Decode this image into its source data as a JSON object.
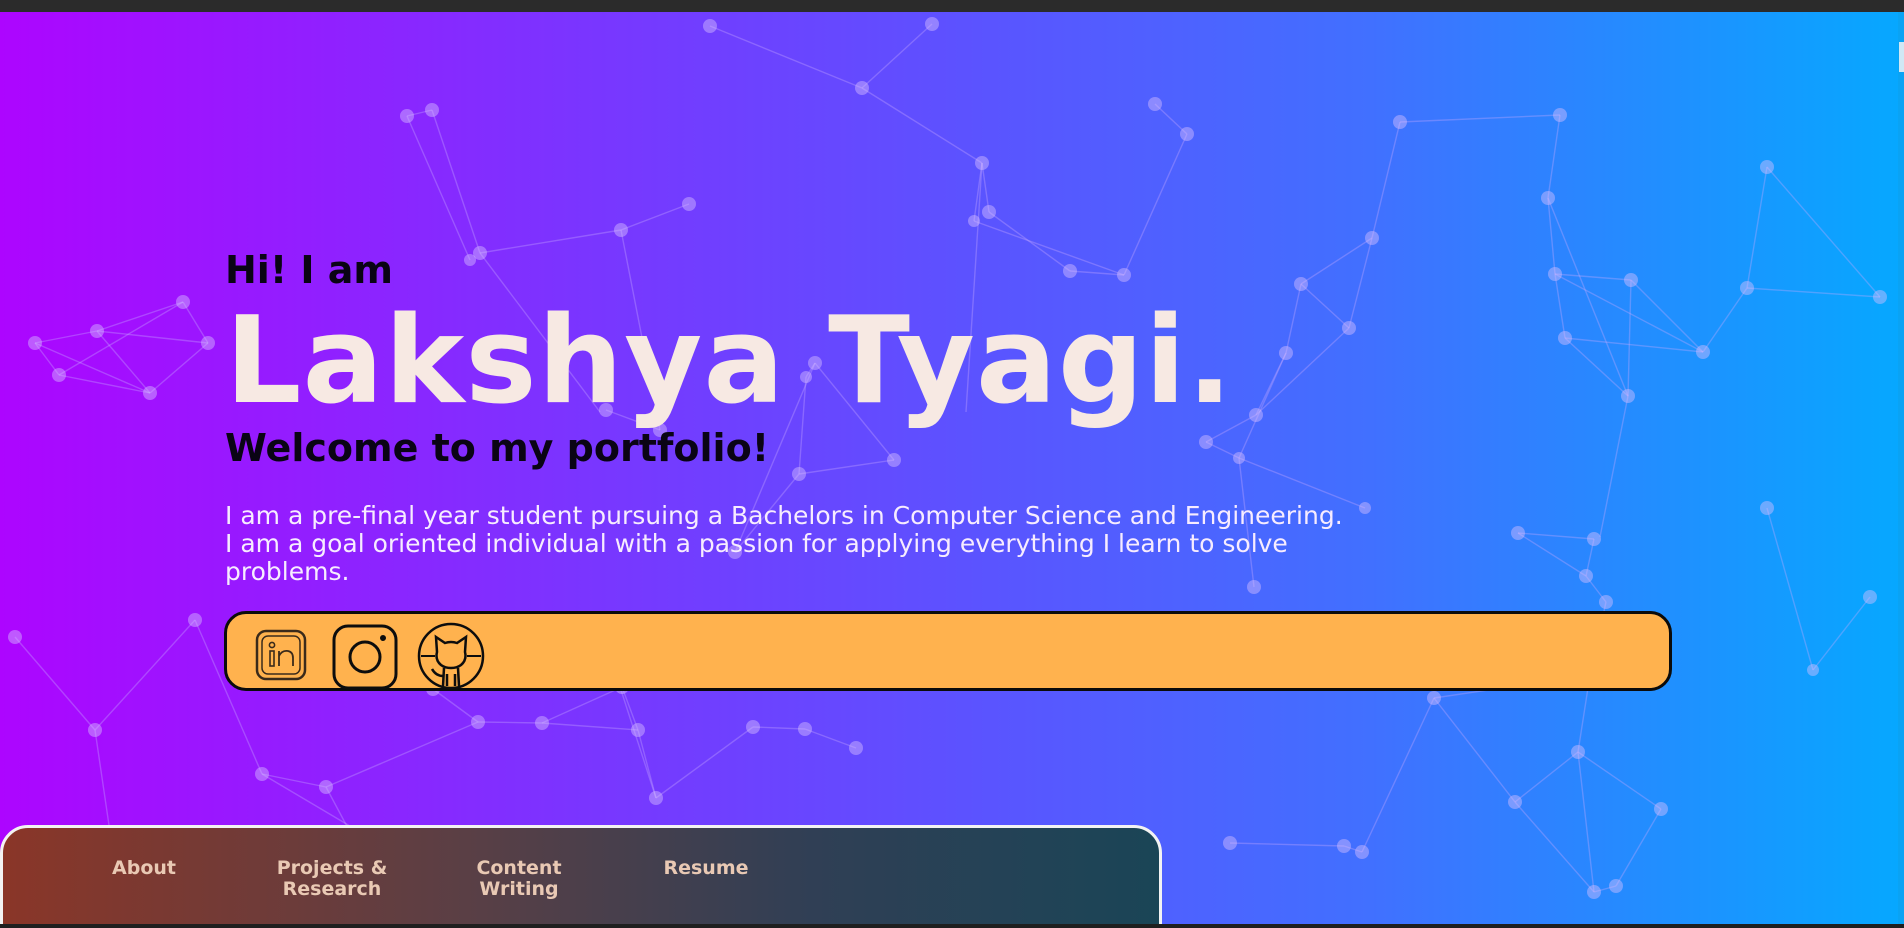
{
  "hero": {
    "greeting": "Hi! I am",
    "name": "Lakshya Tyagi.",
    "welcome": "Welcome to my portfolio!",
    "bio": "I am a pre-final year student pursuing a Bachelors in Computer Science and Engineering. I am a goal oriented individual with a passion for applying everything I learn to solve problems."
  },
  "social": {
    "icons": [
      "linkedin-icon",
      "instagram-icon",
      "github-icon"
    ]
  },
  "nav": {
    "items": [
      {
        "label": "About"
      },
      {
        "label": "Projects & Research"
      },
      {
        "label": "Content Writing"
      },
      {
        "label": "Resume"
      }
    ]
  },
  "colors": {
    "gradient_start": "#ad05ff",
    "gradient_end": "#06a8ff",
    "name_text": "#f7e9e3",
    "social_bar": "#ffb24e",
    "nav_text": "#e9c9b4"
  }
}
